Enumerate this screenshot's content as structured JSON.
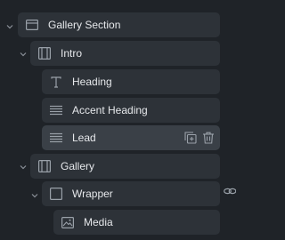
{
  "layers": {
    "gallery_section": {
      "label": "Gallery Section",
      "icon": "section-icon",
      "expanded": true
    },
    "intro": {
      "label": "Intro",
      "icon": "container-icon",
      "expanded": true
    },
    "heading": {
      "label": "Heading",
      "icon": "text-icon"
    },
    "accent_heading": {
      "label": "Accent Heading",
      "icon": "paragraph-icon"
    },
    "lead": {
      "label": "Lead",
      "icon": "paragraph-icon",
      "selected": true,
      "actions": [
        "duplicate-icon",
        "trash-icon"
      ]
    },
    "gallery": {
      "label": "Gallery",
      "icon": "container-icon",
      "expanded": true
    },
    "wrapper": {
      "label": "Wrapper",
      "icon": "box-icon",
      "expanded": true,
      "side_icon": "link-icon"
    },
    "media": {
      "label": "Media",
      "icon": "image-icon"
    }
  },
  "colors": {
    "background": "#1f2328",
    "row": "#2d3238",
    "row_selected": "#3a4047",
    "text": "#e6e8eb",
    "icon": "#9aa1a9"
  }
}
